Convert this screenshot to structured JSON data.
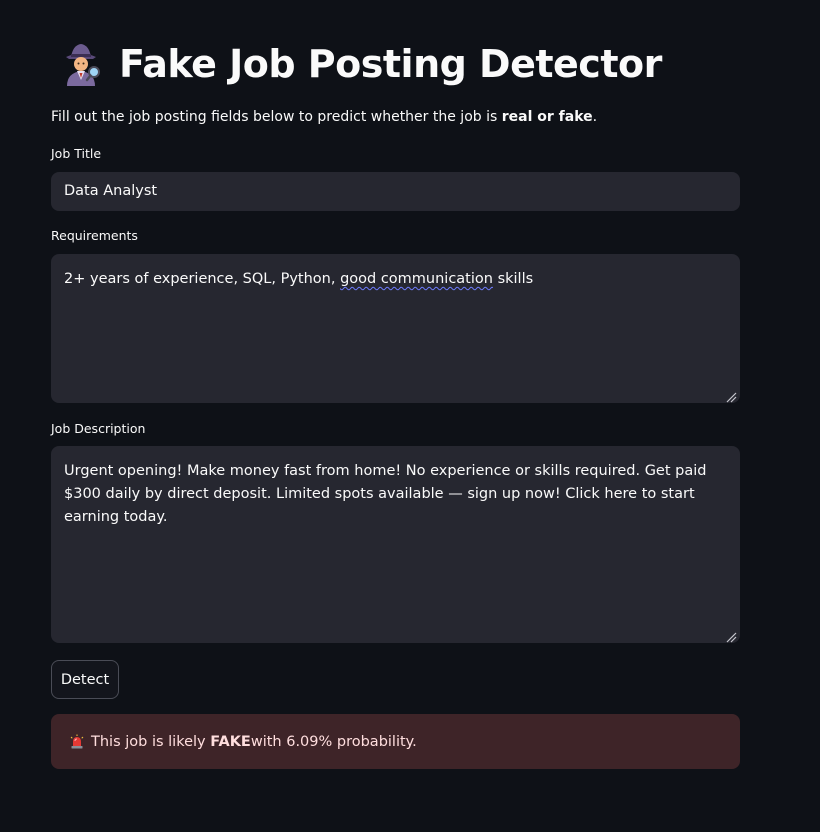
{
  "header": {
    "icon": "detective-icon",
    "title": "Fake Job Posting Detector"
  },
  "intro": {
    "text_before": "Fill out the job posting fields below to predict whether the job is ",
    "text_bold": "real or fake",
    "text_after": "."
  },
  "form": {
    "job_title": {
      "label": "Job Title",
      "value": "Data Analyst"
    },
    "requirements": {
      "label": "Requirements",
      "value_before": "2+ years of experience, SQL, Python, ",
      "value_spellflag": "good communication",
      "value_after": " skills"
    },
    "description": {
      "label": "Job Description",
      "value": "Urgent opening! Make money fast from home! No experience or skills required. Get paid $300 daily by direct deposit. Limited spots available — sign up now! Click here to start earning today."
    },
    "detect_button": "Detect"
  },
  "result": {
    "icon": "siren-icon",
    "text_before": "This job is likely ",
    "text_bold": "FAKE",
    "text_after": " with 6.09% probability."
  },
  "colors": {
    "background": "#0e1117",
    "input_background": "#262730",
    "alert_background": "#3e2428",
    "text": "#fafafa"
  }
}
